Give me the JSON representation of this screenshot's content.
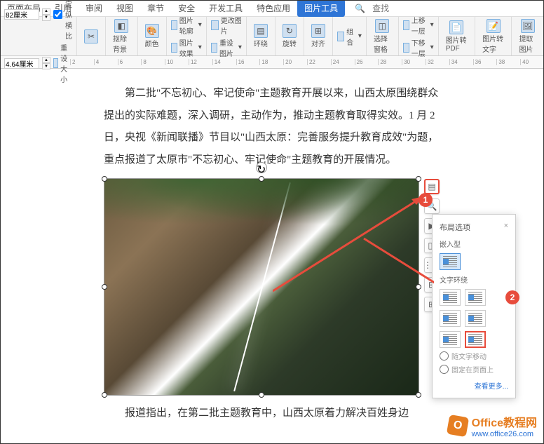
{
  "tabs": {
    "pageLayout": "页面布局",
    "reference": "引用",
    "review": "审阅",
    "view": "视图",
    "chapter": "章节",
    "safety": "安全",
    "devTools": "开发工具",
    "special": "特色应用",
    "imageTools": "图片工具",
    "searchPlaceholder": "查找"
  },
  "toolbar": {
    "width": "82厘米",
    "height": "4.64厘米",
    "lockRatio": "锁定纵横比",
    "resetSize": "重设大小",
    "removeBg": "抠除背景",
    "color": "颜色",
    "effect": "图片效果",
    "resetImg": "重设图片",
    "outline": "图片轮廓",
    "changeImg": "更改图片",
    "wrap": "环绕",
    "rotate": "旋转",
    "align": "对齐",
    "group": "组合",
    "select": "选择窗格",
    "upLayer": "上移一层",
    "downLayer": "下移一层",
    "toPdf": "图片转PDF",
    "toText": "图片转文字",
    "extractImg": "提取图片"
  },
  "document": {
    "p1": "　　第二批\"不忘初心、牢记使命\"主题教育开展以来，山西太原围绕群众提出的实际难题，深入调研，主动作为，推动主题教育取得实效。1 月 2 日，央视《新闻联播》节目以\"山西太原：完善服务提升教育成效\"为题，重点报道了太原市\"不忘初心、牢记使命\"主题教育的开展情况。",
    "p2": "　　报道指出，在第二批主题教育中，山西太原着力解决百姓身边"
  },
  "popup": {
    "title": "布局选项",
    "inline": "嵌入型",
    "textWrap": "文字环绕",
    "moveWithText": "随文字移动",
    "fixOnPage": "固定在页面上",
    "seeMore": "查看更多..."
  },
  "markers": {
    "one": "1",
    "two": "2"
  },
  "watermark": {
    "title": "Office教程网",
    "url": "www.office26.com"
  }
}
